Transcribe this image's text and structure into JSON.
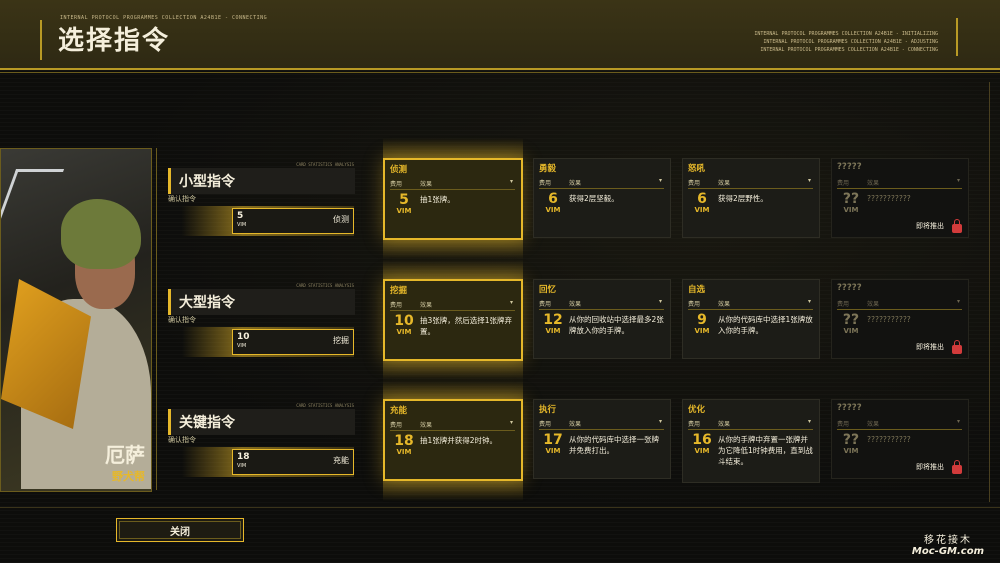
{
  "header": {
    "title": "选择指令",
    "protocol_left": "INTERNAL PROTOCOL PROGRAMMES COLLECTION A24B1E - CONNECTING",
    "protocol_right": [
      "INTERNAL PROTOCOL PROGRAMMES COLLECTION A24B1E - INITIALIZING",
      "INTERNAL PROTOCOL PROGRAMMES COLLECTION A24B1E - ADJUSTING",
      "INTERNAL PROTOCOL PROGRAMMES COLLECTION A24B1E - CONNECTING"
    ]
  },
  "character": {
    "name": "厄萨",
    "faction": "野犬帮"
  },
  "labels": {
    "cost": "费用",
    "effect": "效果",
    "vim": "VIM",
    "coming_soon": "即将推出",
    "cat_tiny": "CARD STATISTICS ANALYSIS"
  },
  "rows": [
    {
      "category": "小型指令",
      "subtitle": "确认指令",
      "slot": {
        "cost": "5",
        "name": "侦测"
      },
      "cards": [
        {
          "name": "侦测",
          "cost": "5",
          "desc": "抽1张牌。",
          "selected": true
        },
        {
          "name": "勇毅",
          "cost": "6",
          "desc": "获得2层坚毅。"
        },
        {
          "name": "怒吼",
          "cost": "6",
          "desc": "获得2层野性。"
        },
        {
          "name": "?????",
          "cost": "??",
          "desc": "???????????",
          "locked": true
        }
      ]
    },
    {
      "category": "大型指令",
      "subtitle": "确认指令",
      "slot": {
        "cost": "10",
        "name": "挖掘"
      },
      "cards": [
        {
          "name": "挖掘",
          "cost": "10",
          "desc": "抽3张牌，然后选择1张牌弃置。",
          "selected": true
        },
        {
          "name": "回忆",
          "cost": "12",
          "desc": "从你的回收站中选择最多2张牌放入你的手牌。"
        },
        {
          "name": "自选",
          "cost": "9",
          "desc": "从你的代码库中选择1张牌放入你的手牌。"
        },
        {
          "name": "?????",
          "cost": "??",
          "desc": "???????????",
          "locked": true
        }
      ]
    },
    {
      "category": "关键指令",
      "subtitle": "确认指令",
      "slot": {
        "cost": "18",
        "name": "充能"
      },
      "cards": [
        {
          "name": "充能",
          "cost": "18",
          "desc": "抽1张牌并获得2时钟。",
          "selected": true
        },
        {
          "name": "执行",
          "cost": "17",
          "desc": "从你的代码库中选择一张牌并免费打出。"
        },
        {
          "name": "优化",
          "cost": "16",
          "desc": "从你的手牌中弃置一张牌并为它降低1时钟费用，直到战斗结束。"
        },
        {
          "name": "?????",
          "cost": "??",
          "desc": "???????????",
          "locked": true
        }
      ]
    }
  ],
  "footer": {
    "close_label": "关闭",
    "watermark_1": "移花接木",
    "watermark_2": "Moc-GM.com"
  }
}
